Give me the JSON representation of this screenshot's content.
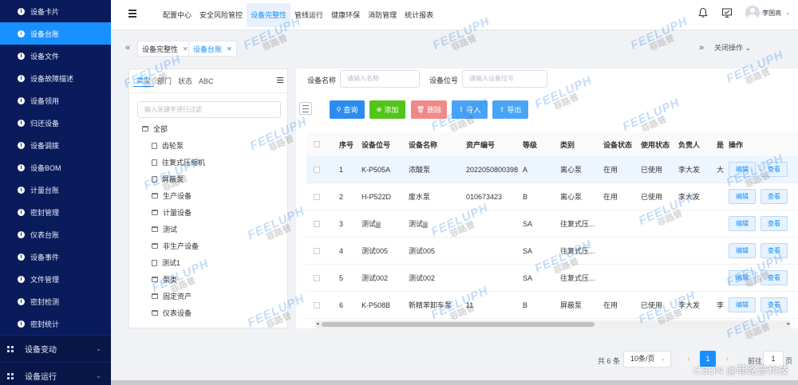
{
  "sidebar": {
    "items": [
      {
        "label": "设备卡片",
        "active": false
      },
      {
        "label": "设备台账",
        "active": true
      },
      {
        "label": "设备文件",
        "active": false
      },
      {
        "label": "设备故障描述",
        "active": false
      },
      {
        "label": "设备领用",
        "active": false
      },
      {
        "label": "归还设备",
        "active": false
      },
      {
        "label": "设备调拨",
        "active": false
      },
      {
        "label": "设备BOM",
        "active": false
      },
      {
        "label": "计量台账",
        "active": false
      },
      {
        "label": "密封管理",
        "active": false
      },
      {
        "label": "仪表台账",
        "active": false
      },
      {
        "label": "设备事件",
        "active": false
      },
      {
        "label": "文件管理",
        "active": false
      },
      {
        "label": "密封检测",
        "active": false
      },
      {
        "label": "密封统计",
        "active": false
      }
    ],
    "groups": [
      {
        "label": "设备变动"
      },
      {
        "label": "设备运行"
      }
    ]
  },
  "header": {
    "nav": [
      {
        "label": "配置中心",
        "active": false
      },
      {
        "label": "安全风险管控",
        "active": false
      },
      {
        "label": "设备完整性",
        "active": true
      },
      {
        "label": "管线运行",
        "active": false
      },
      {
        "label": "健康环保",
        "active": false
      },
      {
        "label": "消防管理",
        "active": false
      },
      {
        "label": "统计报表",
        "active": false
      }
    ],
    "username": "李国亮"
  },
  "tabs": {
    "items": [
      {
        "label": "设备完整性",
        "active": false
      },
      {
        "label": "设备台账",
        "active": true
      }
    ],
    "close_label": "关闭操作"
  },
  "tree": {
    "tabs": [
      "类型",
      "部门",
      "状态",
      "ABC"
    ],
    "search_placeholder": "输入关键字进行过滤",
    "root": "全部",
    "nodes": [
      {
        "label": "齿轮泵",
        "kind": "file",
        "indent": 2
      },
      {
        "label": "往复式压缩机",
        "kind": "file",
        "indent": 2
      },
      {
        "label": "屏蔽泵",
        "kind": "file",
        "indent": 2
      },
      {
        "label": "生产设备",
        "kind": "folder",
        "indent": 2
      },
      {
        "label": "计量设备",
        "kind": "folder",
        "indent": 2
      },
      {
        "label": "测试",
        "kind": "folder",
        "indent": 2
      },
      {
        "label": "非生产设备",
        "kind": "folder",
        "indent": 2
      },
      {
        "label": "测试1",
        "kind": "file",
        "indent": 2
      },
      {
        "label": "泵类",
        "kind": "folder",
        "indent": 2
      },
      {
        "label": "固定资产",
        "kind": "folder",
        "indent": 2
      },
      {
        "label": "仪表设备",
        "kind": "folder",
        "indent": 2
      }
    ]
  },
  "filters": {
    "name_label": "设备名称",
    "name_placeholder": "请输入名称",
    "code_label": "设备位号",
    "code_placeholder": "请输入设备位号"
  },
  "toolbar": {
    "query": "查询",
    "add": "添加",
    "delete": "删除",
    "import": "导入",
    "export": "导出"
  },
  "table": {
    "columns": [
      "序号",
      "设备位号",
      "设备名称",
      "资产编号",
      "等级",
      "类别",
      "设备状态",
      "使用状态",
      "负责人",
      "是",
      "操作"
    ],
    "rows": [
      {
        "no": "1",
        "code": "K-P505A",
        "name": "浓酸泵",
        "asset": "2022050800398",
        "level": "A",
        "type": "离心泵",
        "dstat": "在用",
        "ustat": "已使用",
        "owner": "李大发",
        "ex": "大",
        "hl": true
      },
      {
        "no": "2",
        "code": "H-P522D",
        "name": "废水泵",
        "asset": "010673423",
        "level": "B",
        "type": "离心泵",
        "dstat": "在用",
        "ustat": "已使用",
        "owner": "李大发",
        "ex": "",
        "hl": false
      },
      {
        "no": "3",
        "code": "测试jjj",
        "name": "测试jjj",
        "asset": "",
        "level": "SA",
        "type": "往复式压...",
        "dstat": "",
        "ustat": "",
        "owner": "",
        "ex": "",
        "hl": false
      },
      {
        "no": "4",
        "code": "测试005",
        "name": "测试005",
        "asset": "",
        "level": "SA",
        "type": "往复式压...",
        "dstat": "",
        "ustat": "",
        "owner": "",
        "ex": "",
        "hl": false
      },
      {
        "no": "5",
        "code": "测试002",
        "name": "测试002",
        "asset": "",
        "level": "SA",
        "type": "往复式压...",
        "dstat": "",
        "ustat": "",
        "owner": "",
        "ex": "",
        "hl": false
      },
      {
        "no": "6",
        "code": "K-P508B",
        "name": "新精苯卸车泵",
        "asset": "11",
        "level": "B",
        "type": "屏蔽泵",
        "dstat": "在用",
        "ustat": "已使用",
        "owner": "李大发",
        "ex": "李",
        "hl": false
      }
    ],
    "edit_label": "编辑",
    "view_label": "查看"
  },
  "pager": {
    "total": "共 6 条",
    "page_size": "10条/页",
    "current": "1",
    "goto_label": "前往",
    "goto_value": "1",
    "unit": "页"
  },
  "watermark": {
    "brand": "FEELUPH",
    "cn": "菲路普"
  },
  "credit": "CSDN @菲路普科技",
  "colors": {
    "sidebar_bg": "#0a1b5c",
    "primary": "#1890ff",
    "add_green": "#52c41a",
    "delete_pink": "#f08a8a"
  }
}
